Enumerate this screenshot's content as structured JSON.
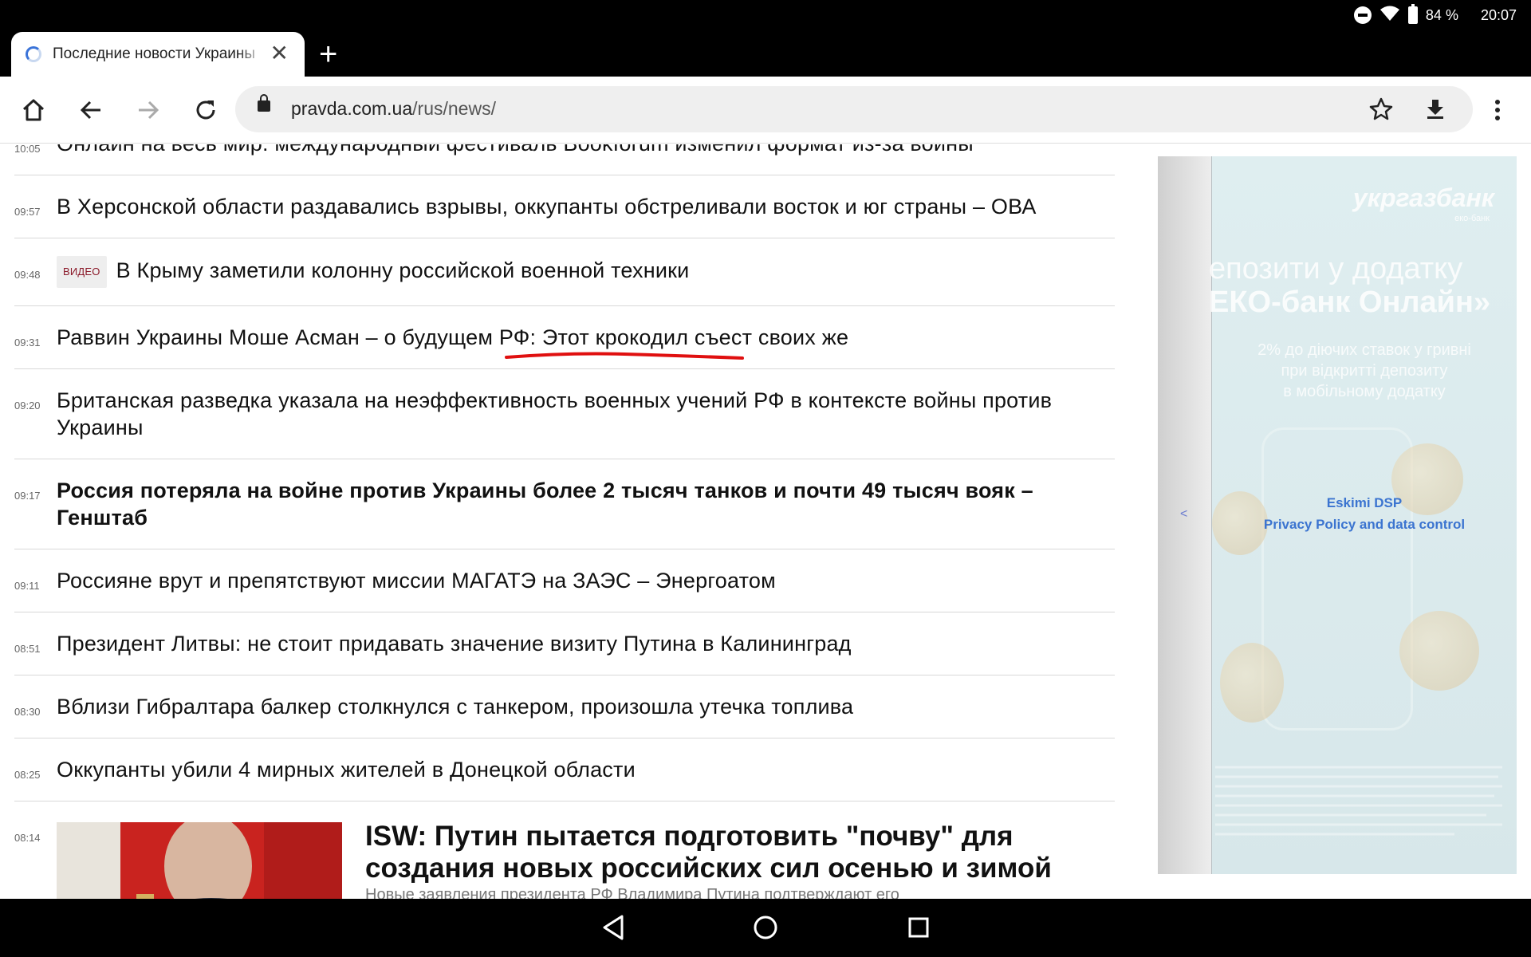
{
  "status_bar": {
    "battery": "84 %",
    "time": "20:07"
  },
  "tab": {
    "title": "Последние новости Украины",
    "close": "✕",
    "new_tab": "+"
  },
  "toolbar": {
    "url_host": "pravda.com.ua",
    "url_path": "/rus/news/"
  },
  "news": [
    {
      "time": "10:05",
      "title": "Онлайн на весь мир: международный фестиваль Bookforum изменил формат из-за войны",
      "bold": false
    },
    {
      "time": "09:57",
      "title": "В Херсонской области раздавались взрывы, оккупанты обстреливали восток и юг страны – ОВА",
      "bold": false
    },
    {
      "time": "09:48",
      "badge": "ВИДЕО",
      "title": "В Крыму заметили колонну российской военной техники",
      "bold": false
    },
    {
      "time": "09:31",
      "title": "Раввин Украины Моше Асман – о будущем РФ: Этот крокодил съест своих же",
      "bold": false
    },
    {
      "time": "09:20",
      "title": "Британская разведка указала на неэффективность военных учений РФ в контексте войны против Украины",
      "bold": false
    },
    {
      "time": "09:17",
      "title": "Россия потеряла на войне против Украины более 2 тысяч танков и почти 49 тысяч вояк – Генштаб",
      "bold": true
    },
    {
      "time": "09:11",
      "title": "Россияне врут и препятствуют миссии МАГАТЭ на ЗАЭС – Энергоатом",
      "bold": false
    },
    {
      "time": "08:51",
      "title": "Президент Литвы: не стоит придавать значение визиту Путина в Калининград",
      "bold": false
    },
    {
      "time": "08:30",
      "title": "Вблизи Гибралтара балкер столкнулся с танкером, произошла утечка топлива",
      "bold": false
    },
    {
      "time": "08:25",
      "title": "Оккупанты убили 4 мирных жителей в Донецкой области",
      "bold": false
    }
  ],
  "feature": {
    "time": "08:14",
    "title": "ISW: Путин пытается подготовить \"почву\" для создания новых российских сил осенью и зимой",
    "subtitle": "Новые заявления президента РФ Владимира Путина подтверждают его"
  },
  "ad": {
    "brand": "укргазбанк",
    "brand_sub": "еко-банк",
    "headline1": "епозити у додатку",
    "headline2": "ЕКО-банк Онлайн»",
    "line1": "2% до діючих ставок у гривні",
    "line2": "при відкритті депозиту",
    "line3": "в мобільному додатку",
    "arrow": "<",
    "link1": "Eskimi DSP",
    "link2": "Privacy Policy and data control"
  }
}
